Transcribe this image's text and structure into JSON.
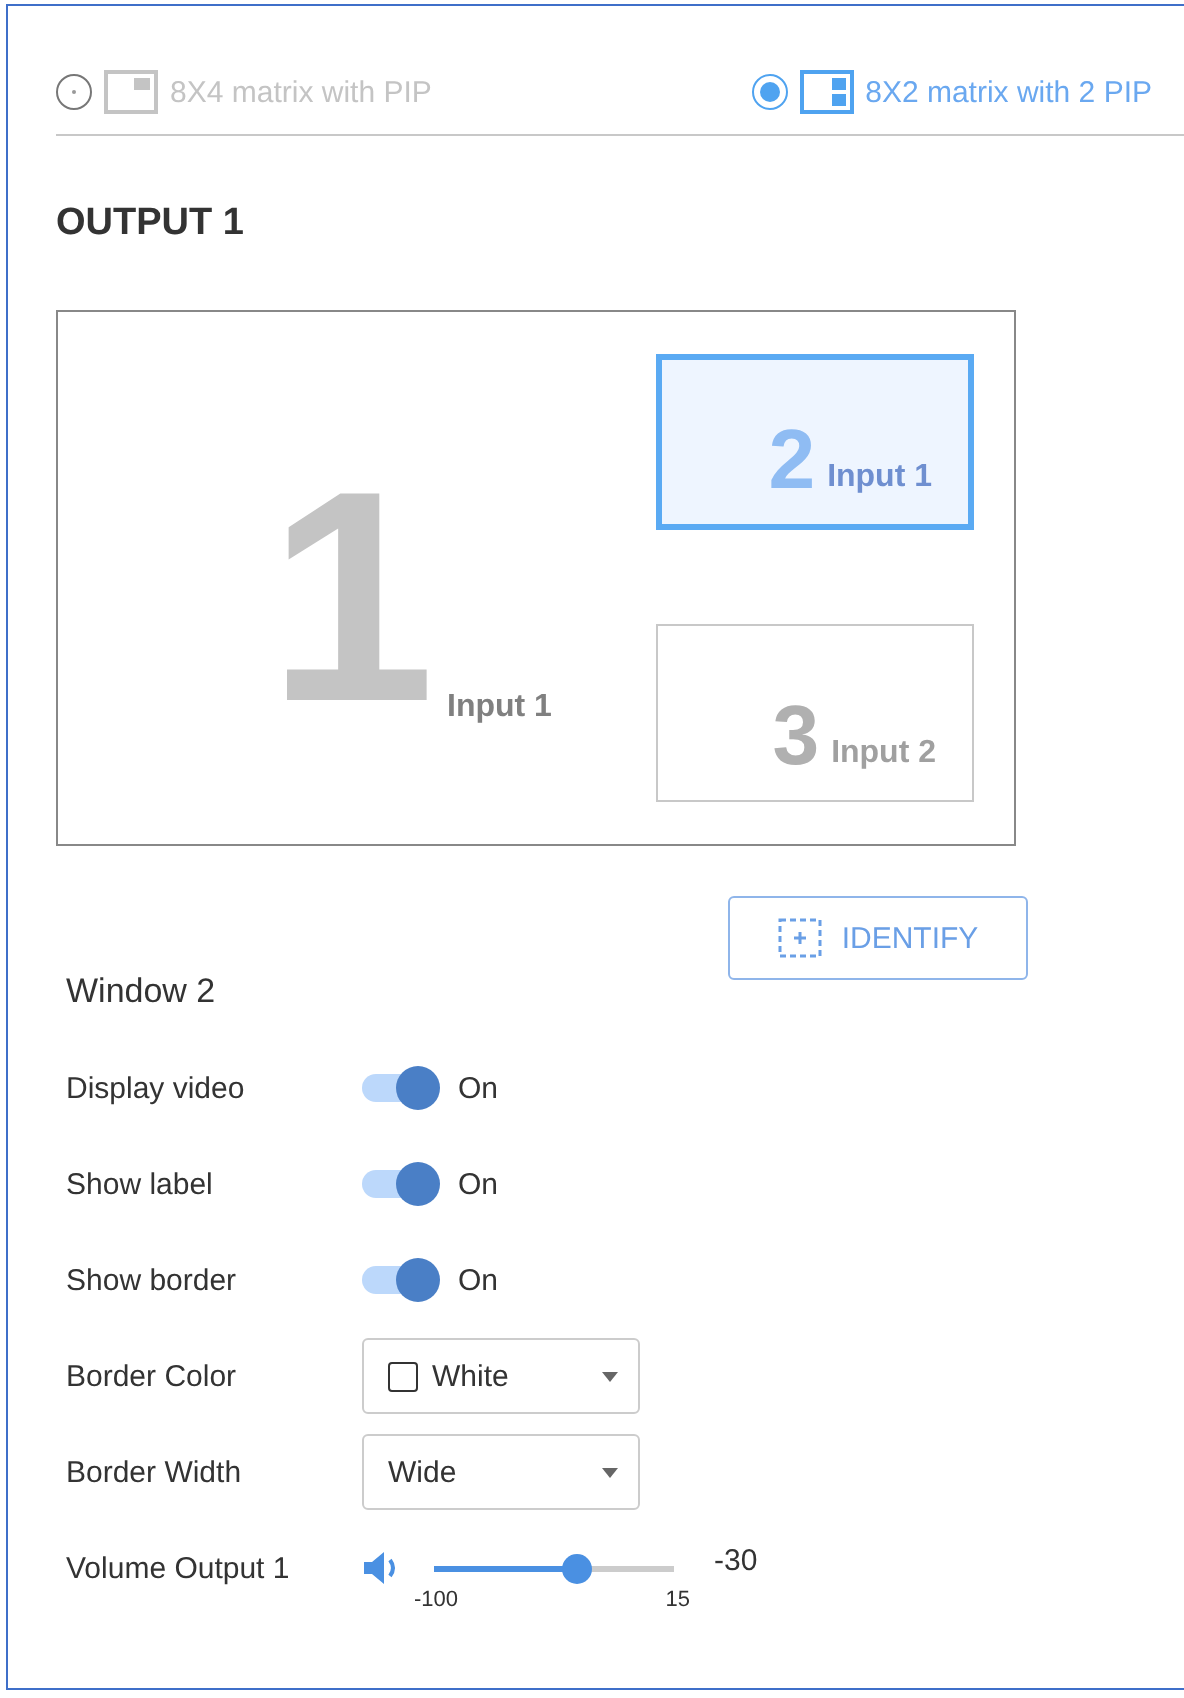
{
  "modes": [
    {
      "label": "8X4 matrix with PIP",
      "selected": false,
      "kind": "single-pip"
    },
    {
      "label": "8X2 matrix with 2 PIP",
      "selected": true,
      "kind": "dual-pip"
    }
  ],
  "output_title": "OUTPUT 1",
  "preview": {
    "windows": [
      {
        "kind": "main",
        "number": "1",
        "label": "Input 1",
        "selected": false
      },
      {
        "kind": "pip",
        "number": "2",
        "label": "Input 1",
        "selected": true
      },
      {
        "kind": "pip",
        "number": "3",
        "label": "Input 2",
        "selected": false
      }
    ]
  },
  "identify_button": "IDENTIFY",
  "window_title": "Window 2",
  "settings": [
    {
      "kind": "toggle",
      "label": "Display video",
      "on": true,
      "value": "On"
    },
    {
      "kind": "toggle",
      "label": "Show label",
      "on": true,
      "value": "On"
    },
    {
      "kind": "toggle",
      "label": "Show border",
      "on": true,
      "value": "On"
    },
    {
      "kind": "dropdown",
      "label": "Border Color",
      "value": "White",
      "color": "#ffffff"
    },
    {
      "kind": "dropdown",
      "label": "Border Width",
      "value": "Wide"
    },
    {
      "kind": "slider",
      "label": "Volume Output 1",
      "level": 0.61,
      "min": "-100",
      "max": "15",
      "value": "-30"
    }
  ]
}
